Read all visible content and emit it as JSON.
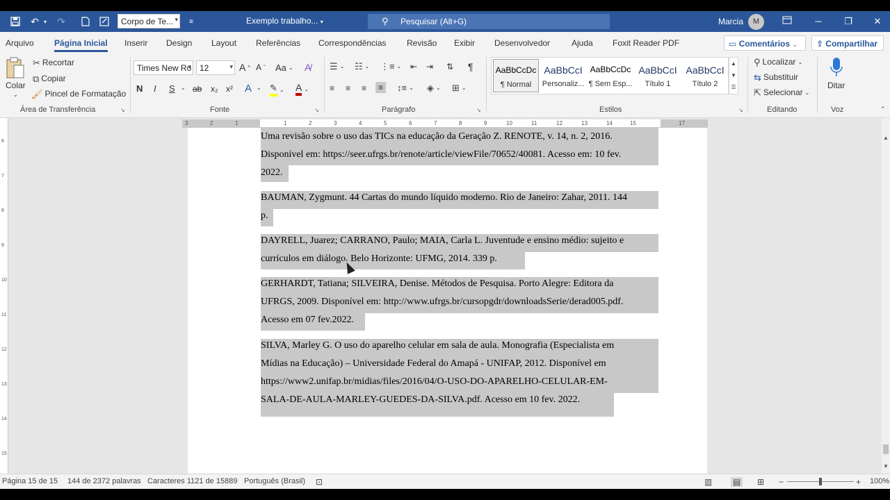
{
  "titlebar": {
    "style_box_value": "Corpo de Te...",
    "doc_title": "Exemplo trabalho...",
    "search_placeholder": "Pesquisar (Alt+G)",
    "user_name": "Marcia",
    "avatar_initial": "M"
  },
  "tabs": [
    "Arquivo",
    "Página Inicial",
    "Inserir",
    "Design",
    "Layout",
    "Referências",
    "Correspondências",
    "Revisão",
    "Exibir",
    "Desenvolvedor",
    "Ajuda",
    "Foxit Reader PDF"
  ],
  "tab_buttons": {
    "comments": "Comentários",
    "share": "Compartilhar"
  },
  "clipboard": {
    "paste": "Colar",
    "cut": "Recortar",
    "copy": "Copiar",
    "format_painter": "Pincel de Formatação",
    "label": "Área de Transferência"
  },
  "font": {
    "family": "Times New Ro",
    "size": "12",
    "bold": "N",
    "italic": "I",
    "underline": "S",
    "strike": "ab",
    "subscript": "x₂",
    "superscript": "x²",
    "case": "Aa",
    "grow": "A",
    "shrink": "A",
    "label": "Fonte"
  },
  "paragraph": {
    "label": "Parágrafo",
    "pilcrow": "¶"
  },
  "styles": {
    "items": [
      {
        "preview": "AaBbCcDc",
        "name": "¶ Normal"
      },
      {
        "preview": "AaBbCcI",
        "name": "Personaliz..."
      },
      {
        "preview": "AaBbCcDc",
        "name": "¶ Sem Esp..."
      },
      {
        "preview": "AaBbCcI",
        "name": "Título 1"
      },
      {
        "preview": "AaBbCcI",
        "name": "Título 2"
      }
    ],
    "label": "Estilos"
  },
  "editing": {
    "find": "Localizar",
    "replace": "Substituir",
    "select": "Selecionar",
    "label": "Editando"
  },
  "voice": {
    "dictate": "Ditar",
    "label": "Voz"
  },
  "ruler": {
    "ticks": [
      "3",
      "2",
      "1",
      "1",
      "2",
      "3",
      "4",
      "5",
      "6",
      "7",
      "8",
      "9",
      "10",
      "11",
      "12",
      "13",
      "14",
      "15",
      "17"
    ]
  },
  "document": {
    "paragraphs": [
      [
        "Uma revisão sobre o uso das TICs na educação da Geração Z. RENOTE, v. 14, n. 2, 2016.",
        "Disponível em: https://seer.ufrgs.br/renote/article/viewFile/70652/40081. Acesso em: 10 fev.",
        "2022."
      ],
      [
        "BAUMAN, Zygmunt. 44 Cartas do mundo líquido moderno. Rio de Janeiro: Zahar, 2011. 144",
        "p."
      ],
      [
        "DAYRELL, Juarez; CARRANO, Paulo; MAIA, Carla L. Juventude e ensino médio: sujeito e",
        "currículos em diálogo. Belo Horizonte: UFMG, 2014. 339 p."
      ],
      [
        "GERHARDT, Tatiana; SILVEIRA, Denise. Métodos de Pesquisa. Porto Alegre: Editora da",
        "UFRGS, 2009. Disponível em: http://www.ufrgs.br/cursopgdr/downloadsSerie/derad005.pdf.",
        "Acesso em 07 fev.2022."
      ],
      [
        "SILVA, Marley G. O uso do aparelho celular em sala de aula. Monografia (Especialista em",
        "Mídias  na Educação) – Universidade Federal do Amapá - UNIFAP, 2012. Disponível em",
        "https://www2.unifap.br/midias/files/2016/04/O-USO-DO-APARELHO-CELULAR-EM-",
        "SALA-DE-AULA-MARLEY-GUEDES-DA-SILVA.pdf. Acesso em 10 fev. 2022."
      ]
    ]
  },
  "statusbar": {
    "page": "Página 15 de 15",
    "words": "144 de 2372 palavras",
    "chars": "Caracteres 1121 de 15889",
    "language": "Português (Brasil)",
    "zoom": "100%"
  }
}
